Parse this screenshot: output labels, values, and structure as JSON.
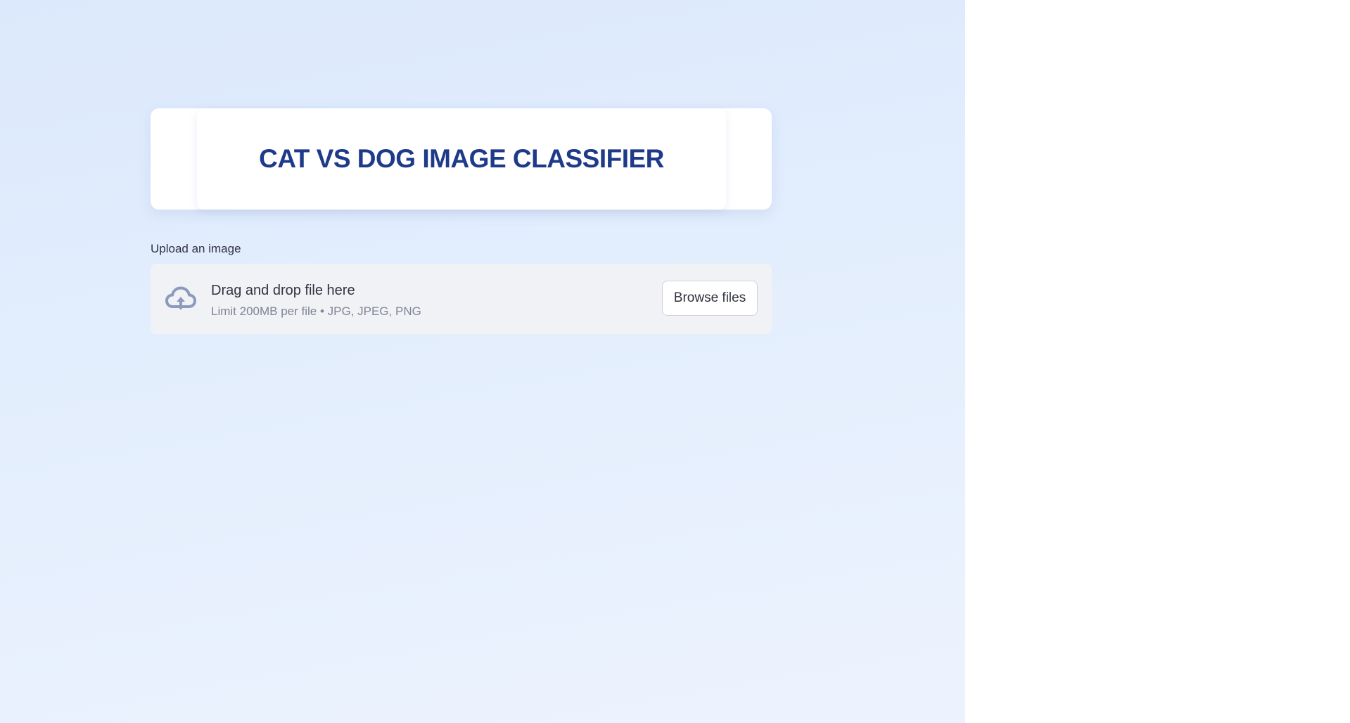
{
  "header": {
    "title": "CAT VS DOG IMAGE CLASSIFIER"
  },
  "uploader": {
    "label": "Upload an image",
    "drop_text": "Drag and drop file here",
    "limit_text": "Limit 200MB per file • JPG, JPEG, PNG",
    "browse_label": "Browse files",
    "icon": "cloud-upload-icon"
  },
  "colors": {
    "title": "#1e3a8a",
    "background_top": "#dce9fc",
    "background_bottom": "#edf3fe",
    "dropzone": "#f0f2f6",
    "icon": "#8b9bbd"
  }
}
